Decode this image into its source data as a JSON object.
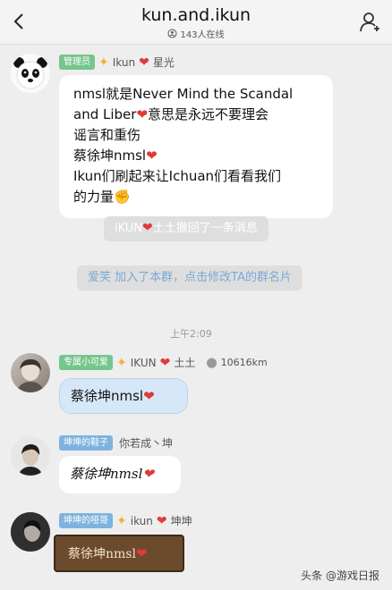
{
  "header": {
    "title": "kun.and.ikun",
    "online": "143人在线"
  },
  "messages": [
    {
      "badge": "管理员",
      "name": "Ikun",
      "name_suffix": "星光",
      "lines": [
        "nmsl就是Never Mind the Scandal",
        "and Liber",
        "意思是永远不要理会",
        "谣言和重伤",
        "蔡徐坤nmsl",
        "Ikun们刷起来让Ichuan们看看我们",
        "的力量"
      ]
    },
    {
      "badge": "专属小可爱",
      "name": "IKUN",
      "name_suffix": "土土",
      "distance": "10616km",
      "text": "蔡徐坤nmsl"
    },
    {
      "badge": "坤坤的鞋子",
      "name": "你若成丶坤",
      "text": "蔡徐坤nmsl"
    },
    {
      "badge": "坤坤的哑哥",
      "name": "ikun",
      "name_suffix": "坤坤",
      "text": "蔡徐坤nmsl"
    }
  ],
  "system": {
    "recall_name": "iKUN",
    "recall_suffix": "土土撤回了一条消息",
    "join_name": "爱笑",
    "join_text": "加入了本群，点击修改TA的群名片"
  },
  "timestamp": "上午2:09",
  "watermark": "头条 @游戏日报",
  "colors": {
    "admin_badge": "#76c58d",
    "member_badge": "#7fb3df",
    "heart": "#e03a3a",
    "star": "#f2b233",
    "bubble_blue": "#d6e8f8",
    "wood_bubble": "#6b4a2e"
  },
  "icons": [
    "back-arrow-icon",
    "people-icon",
    "profile-icon",
    "star-icon",
    "heart-icon",
    "location-icon",
    "fist-emoji-icon"
  ]
}
